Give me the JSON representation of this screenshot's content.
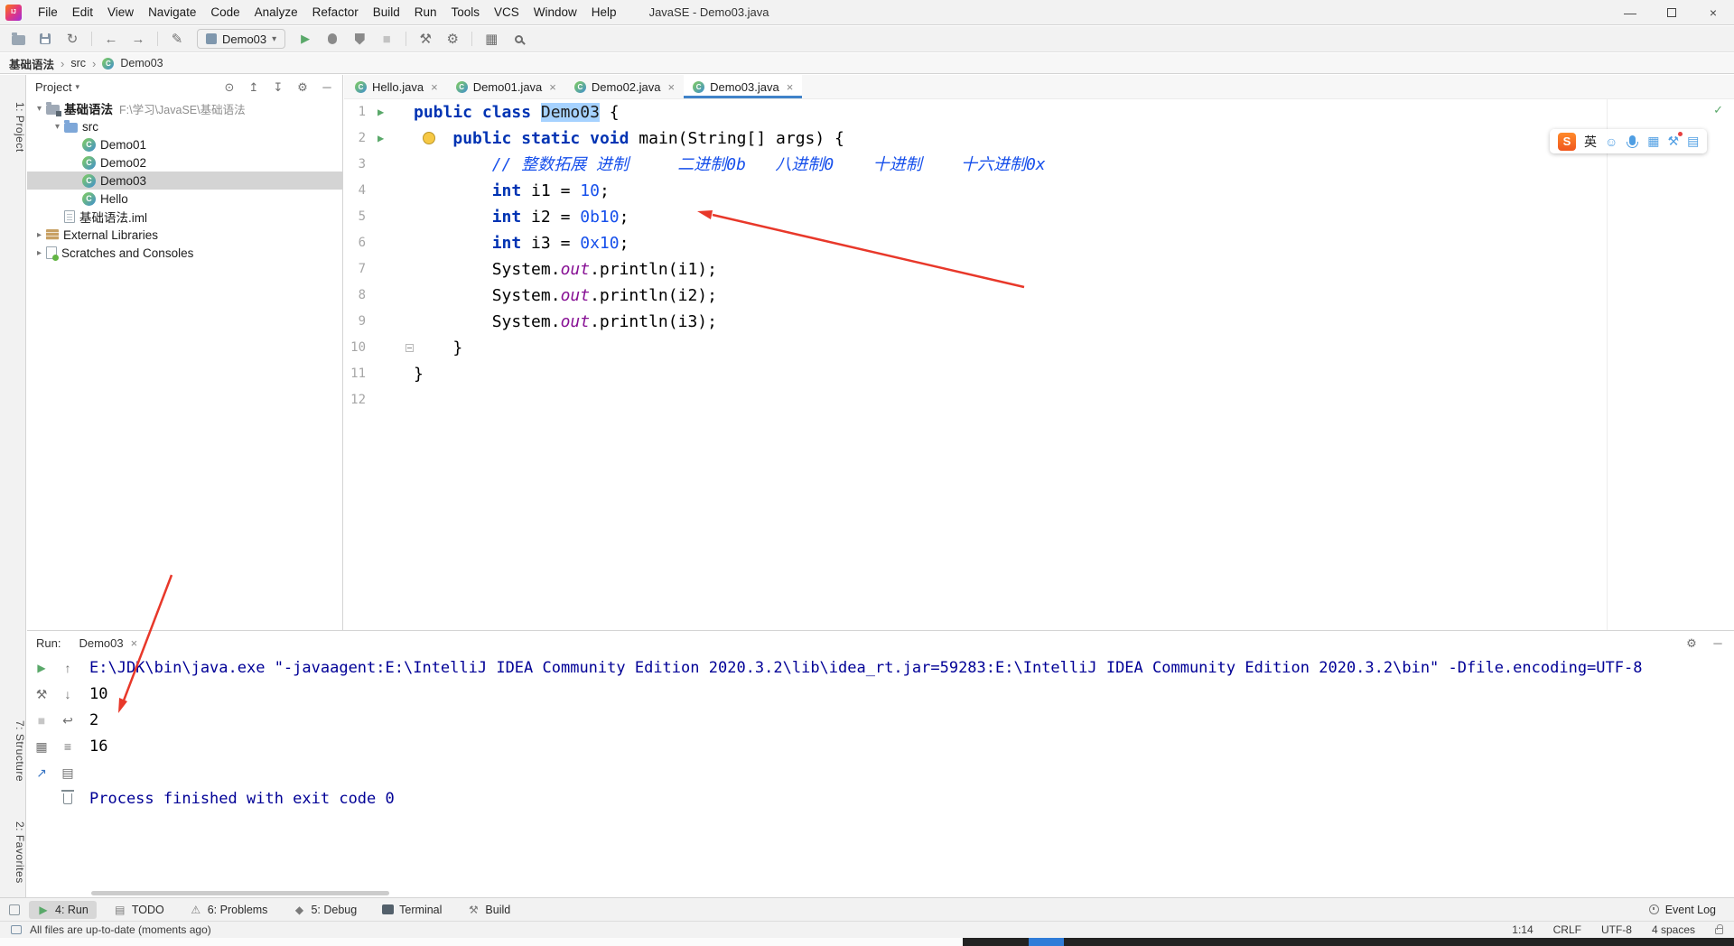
{
  "window": {
    "logo": "IJ",
    "title": "JavaSE - Demo03.java",
    "menus": [
      "File",
      "Edit",
      "View",
      "Navigate",
      "Code",
      "Analyze",
      "Refactor",
      "Build",
      "Run",
      "Tools",
      "VCS",
      "Window",
      "Help"
    ]
  },
  "glyphs": {
    "minimize": "—",
    "close": "×",
    "chevron": "›",
    "caret": "▾",
    "expanded": "▾",
    "collapsed": "▸",
    "run": "▶",
    "back": "←",
    "forward": "→",
    "sync": "↻",
    "pencil": "✎",
    "gear": "⚙",
    "locate": "⊙",
    "expand_all": "↥",
    "collapse_all": "↧",
    "hide": "─",
    "up": "↑",
    "down": "↓",
    "enter": "↩",
    "lines": "≡",
    "list": "▤",
    "grid": "▦",
    "hammer": "⚒",
    "warning": "⚠",
    "diamond": "◆",
    "check": "✓",
    "stop": "■",
    "ne_arrow": "↗",
    "smiley": "☺"
  },
  "toolbar": {
    "run_config": "Demo03"
  },
  "breadcrumb": {
    "items": [
      "基础语法",
      "src",
      "Demo03"
    ]
  },
  "tool_strip": {
    "project": "1: Project",
    "structure": "7: Structure",
    "favorites": "2: Favorites"
  },
  "project_panel": {
    "title": "Project",
    "tree": [
      {
        "label": "基础语法",
        "path": "F:\\学习\\JavaSE\\基础语法",
        "level": 0,
        "icon": "project",
        "state": "expanded",
        "bold": true
      },
      {
        "label": "src",
        "level": 1,
        "icon": "folder",
        "state": "expanded"
      },
      {
        "label": "Demo01",
        "level": 2,
        "icon": "class"
      },
      {
        "label": "Demo02",
        "level": 2,
        "icon": "class"
      },
      {
        "label": "Demo03",
        "level": 2,
        "icon": "class",
        "selected": true
      },
      {
        "label": "Hello",
        "level": 2,
        "icon": "class"
      },
      {
        "label": "基础语法.iml",
        "level": 1,
        "icon": "file"
      },
      {
        "label": "External Libraries",
        "level": 0,
        "icon": "library",
        "state": "collapsed"
      },
      {
        "label": "Scratches and Consoles",
        "level": 0,
        "icon": "scratch",
        "state": "collapsed"
      }
    ]
  },
  "editor": {
    "class_letter": "C",
    "tabs": [
      {
        "label": "Hello.java"
      },
      {
        "label": "Demo01.java"
      },
      {
        "label": "Demo02.java"
      },
      {
        "label": "Demo03.java",
        "active": true
      }
    ],
    "lines": [
      {
        "num": "1",
        "gutter": "run",
        "tokens": [
          [
            "k",
            "public"
          ],
          [
            "p",
            " "
          ],
          [
            "k",
            "class"
          ],
          [
            "p",
            " "
          ],
          [
            "sel",
            "Demo03"
          ],
          [
            "p",
            " {"
          ]
        ]
      },
      {
        "num": "2",
        "gutter": "run",
        "bulb": true,
        "tokens": [
          [
            "p",
            "    "
          ],
          [
            "k",
            "public"
          ],
          [
            "p",
            " "
          ],
          [
            "k",
            "static"
          ],
          [
            "p",
            " "
          ],
          [
            "k",
            "void"
          ],
          [
            "p",
            " main(String[] args) {"
          ]
        ]
      },
      {
        "num": "3",
        "tokens": [
          [
            "p",
            "        "
          ],
          [
            "c",
            "// 整数拓展 进制     二进制0b   八进制0    十进制    十六进制0x"
          ]
        ]
      },
      {
        "num": "4",
        "tokens": [
          [
            "p",
            "        "
          ],
          [
            "k",
            "int"
          ],
          [
            "p",
            " i1 = "
          ],
          [
            "n",
            "10"
          ],
          [
            "p",
            ";"
          ]
        ]
      },
      {
        "num": "5",
        "tokens": [
          [
            "p",
            "        "
          ],
          [
            "k",
            "int"
          ],
          [
            "p",
            " i2 = "
          ],
          [
            "n",
            "0b10"
          ],
          [
            "p",
            ";"
          ]
        ]
      },
      {
        "num": "6",
        "tokens": [
          [
            "p",
            "        "
          ],
          [
            "k",
            "int"
          ],
          [
            "p",
            " i3 = "
          ],
          [
            "n",
            "0x10"
          ],
          [
            "p",
            ";"
          ]
        ]
      },
      {
        "num": "7",
        "tokens": [
          [
            "p",
            "        System."
          ],
          [
            "f",
            "out"
          ],
          [
            "p",
            ".println(i1);"
          ]
        ]
      },
      {
        "num": "8",
        "tokens": [
          [
            "p",
            "        System."
          ],
          [
            "f",
            "out"
          ],
          [
            "p",
            ".println(i2);"
          ]
        ]
      },
      {
        "num": "9",
        "tokens": [
          [
            "p",
            "        System."
          ],
          [
            "f",
            "out"
          ],
          [
            "p",
            ".println(i3);"
          ]
        ]
      },
      {
        "num": "10",
        "fold": "end",
        "tokens": [
          [
            "p",
            "    }"
          ]
        ]
      },
      {
        "num": "11",
        "tokens": [
          [
            "p",
            "}"
          ]
        ]
      },
      {
        "num": "12",
        "tokens": []
      }
    ]
  },
  "run_panel": {
    "label": "Run:",
    "tab": "Demo03",
    "console": [
      {
        "c": "sys",
        "t": "E:\\JDK\\bin\\java.exe \"-javaagent:E:\\IntelliJ IDEA Community Edition 2020.3.2\\lib\\idea_rt.jar=59283:E:\\IntelliJ IDEA Community Edition 2020.3.2\\bin\" -Dfile.encoding=UTF-8"
      },
      {
        "c": "std",
        "t": "10"
      },
      {
        "c": "std",
        "t": "2"
      },
      {
        "c": "std",
        "t": "16"
      },
      {
        "c": "std",
        "t": ""
      },
      {
        "c": "sys",
        "t": "Process finished with exit code 0"
      }
    ]
  },
  "bottom_bar": {
    "items": [
      {
        "label": "4: Run",
        "icon": "run",
        "active": true
      },
      {
        "label": "TODO",
        "icon": "todo"
      },
      {
        "label": "6: Problems",
        "icon": "problems"
      },
      {
        "label": "5: Debug",
        "icon": "debug"
      },
      {
        "label": "Terminal",
        "icon": "terminal"
      },
      {
        "label": "Build",
        "icon": "build"
      }
    ],
    "event_log": "Event Log"
  },
  "status_bar": {
    "message": "All files are up-to-date (moments ago)",
    "position": "1:14",
    "line_sep": "CRLF",
    "encoding": "UTF-8",
    "indent": "4 spaces"
  },
  "ime": {
    "logo": "S",
    "lang": "英"
  },
  "colors": {
    "accent": "#4083c9",
    "keyword": "#0033b3",
    "number": "#1750eb",
    "field": "#871094",
    "selection": "#a6d2ff",
    "run_green": "#59a869",
    "arrow_red": "#e8382a"
  }
}
